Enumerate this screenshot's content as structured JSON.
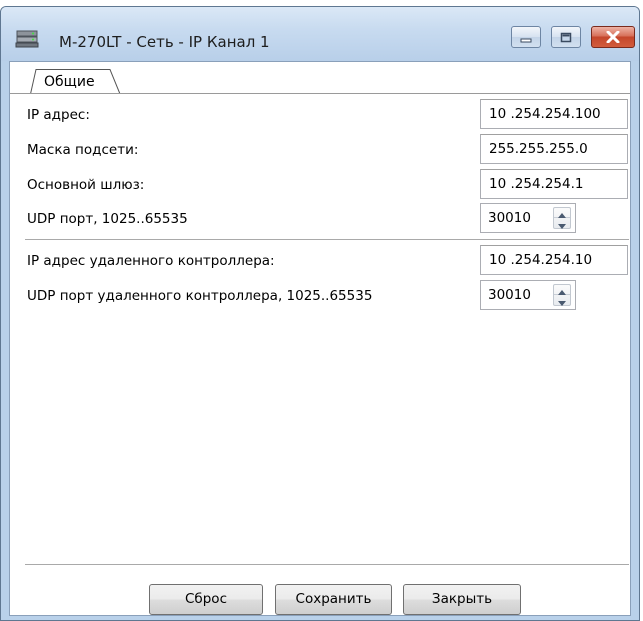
{
  "window": {
    "title": "М-270LT - Сеть - IP Канал 1"
  },
  "tabs": [
    {
      "label": "Общие"
    }
  ],
  "fields": {
    "ip_address": {
      "label": "IP адрес:",
      "value": "10 .254.254.100"
    },
    "subnet_mask": {
      "label": "Маска подсети:",
      "value": "255.255.255.0"
    },
    "gateway": {
      "label": "Основной шлюз:",
      "value": "10 .254.254.1"
    },
    "udp_port": {
      "label": "UDP порт, 1025..65535",
      "value": "30010"
    },
    "remote_ip": {
      "label": "IP адрес удаленного контроллера:",
      "value": "10 .254.254.10"
    },
    "remote_udp_port": {
      "label": "UDP порт удаленного контроллера, 1025..65535",
      "value": "30010"
    }
  },
  "buttons": {
    "reset": "Сброс",
    "save": "Сохранить",
    "close": "Закрыть"
  },
  "icons": {
    "app": "network-device-icon",
    "minimize": "minimize-icon",
    "maximize": "maximize-icon",
    "close": "close-icon",
    "spin_up": "arrow-up-icon",
    "spin_down": "arrow-down-icon"
  },
  "colors": {
    "close_button": "#c4462b",
    "frame": "#b9d1ea"
  }
}
